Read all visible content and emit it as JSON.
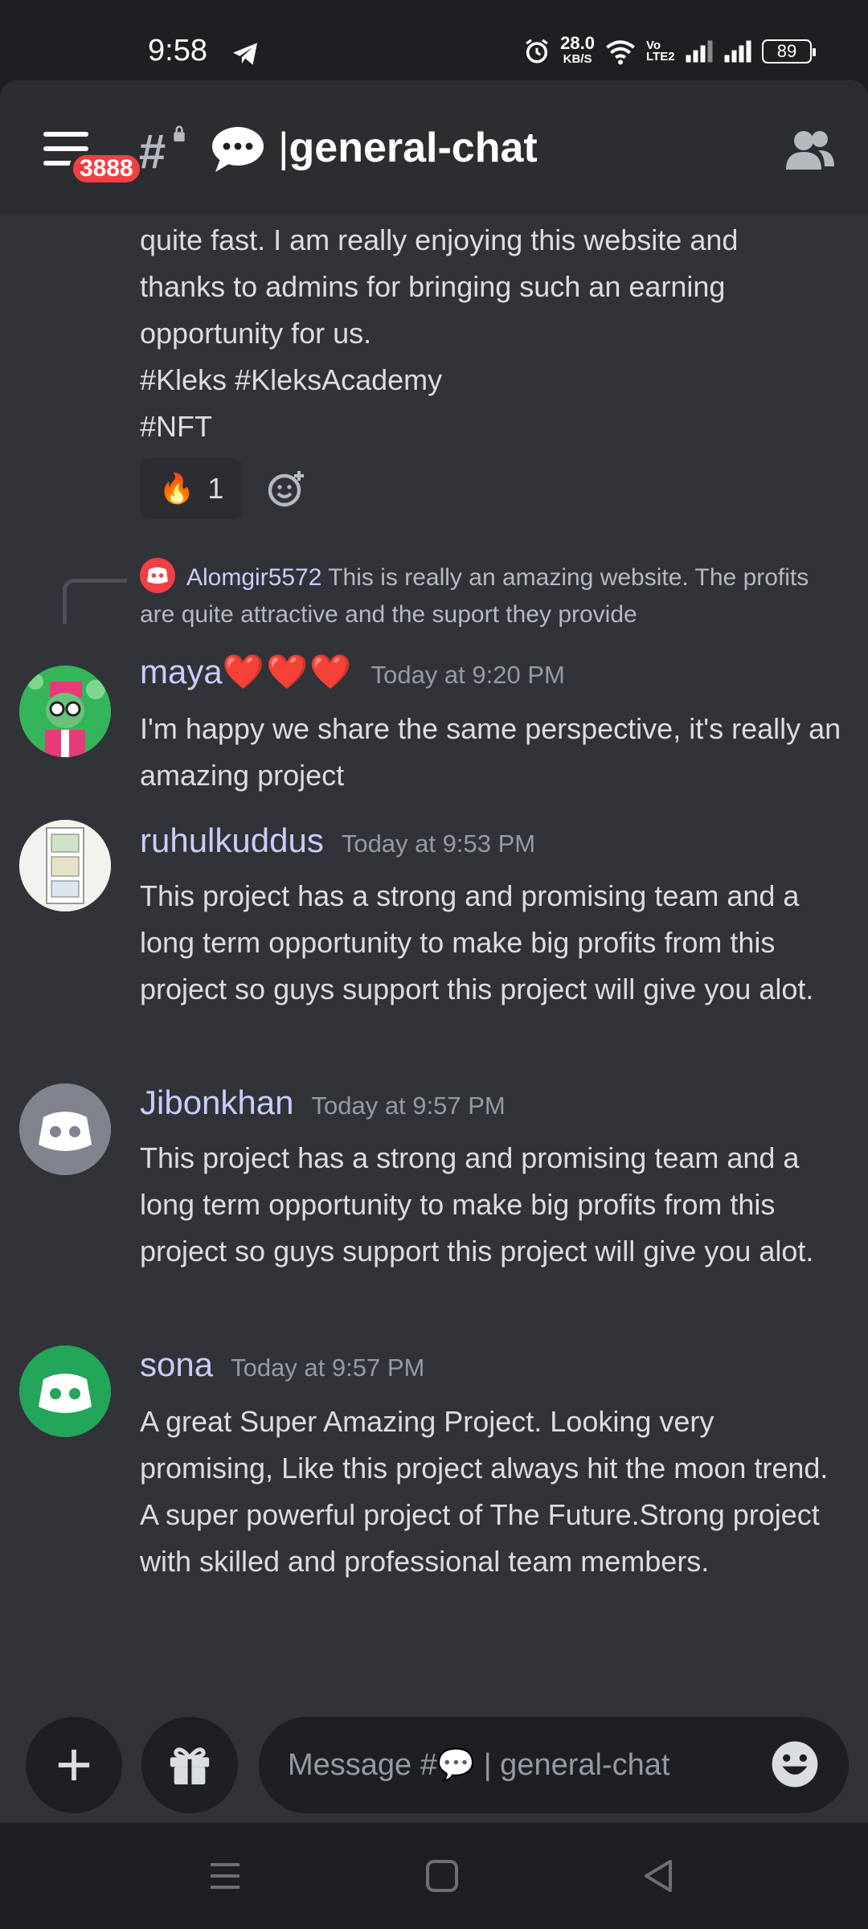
{
  "status_bar": {
    "time": "9:58",
    "net_speed": "28.0",
    "net_unit": "KB/S",
    "volte": "Vo LTE2",
    "battery": "89"
  },
  "header": {
    "badge_count": "3888",
    "channel_name": "general-chat"
  },
  "messages": {
    "top_text_lines": [
      "quite fast. I am really enjoying this website and",
      "thanks to admins for bringing such an earning",
      "opportunity for us.",
      "#Kleks #KleksAcademy",
      "#NFT"
    ],
    "reaction": {
      "emoji": "🔥",
      "count": "1"
    },
    "reply": {
      "author": "Alomgir5572",
      "text": "This is really an amazing website. The profits are quite attractive and the suport they provide"
    },
    "maya": {
      "author": "maya",
      "hearts": "❤️❤️❤️",
      "time": "Today at 9:20 PM",
      "text": "I'm happy we share the same perspective, it's really an amazing project"
    },
    "ruhul": {
      "author": "ruhulkuddus",
      "time": "Today at 9:53 PM",
      "text": "This project has a strong and promising team and a long term opportunity to make big profits from this project so guys support this project will give you alot."
    },
    "jibon": {
      "author": "Jibonkhan",
      "time": "Today at 9:57 PM",
      "text": "This project has a strong and promising team and a long term opportunity to make big profits from this project so guys support this project will give you alot."
    },
    "sona": {
      "author": "sona",
      "time": "Today at 9:57 PM",
      "text": "A great Super Amazing Project. Looking very promising, Like this project always hit the moon trend. A super powerful project of The Future.Strong project with skilled and professional team members."
    }
  },
  "input": {
    "placeholder": "Message #💬 | general-chat"
  },
  "colors": {
    "background": "#313338",
    "header": "#2b2d31",
    "author": "#c9cdfb",
    "timestamp": "#949ba4",
    "badge": "#f23f43",
    "blurple_avatar": "#80848e",
    "green_avatar": "#23a55a"
  }
}
